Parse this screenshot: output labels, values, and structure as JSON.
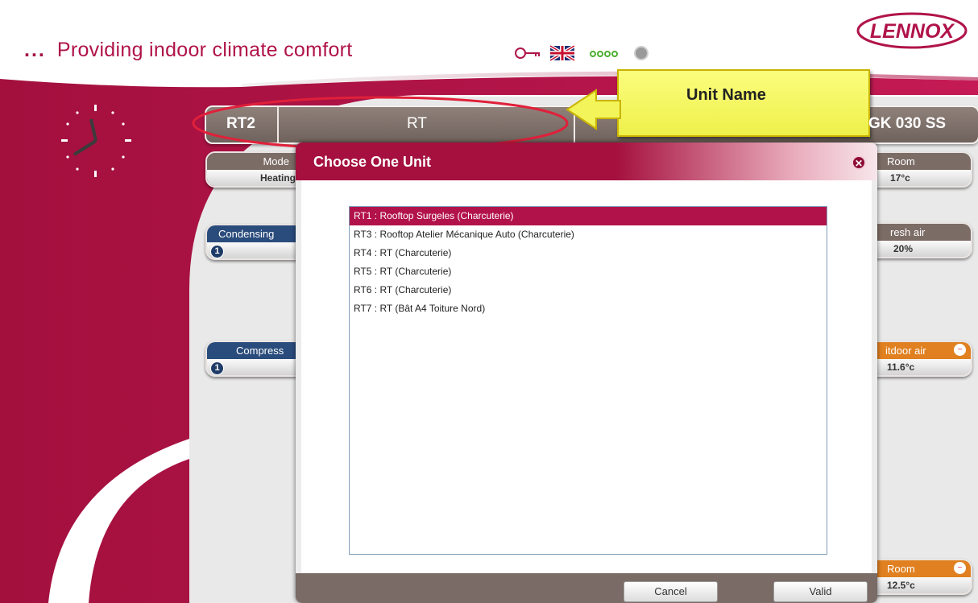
{
  "header": {
    "tagline_dots": "...",
    "tagline": "Providing indoor climate comfort",
    "logo_text": "LENNOX"
  },
  "unit_bar": {
    "unit_id": "RT2",
    "unit_name": "RT",
    "model": "GK 030 SS"
  },
  "callout": {
    "label": "Unit Name"
  },
  "left_panels": {
    "mode": {
      "label": "Mode",
      "value": "Heating"
    },
    "condensing": {
      "label": "Condensing",
      "badge": "1"
    },
    "compressor": {
      "label": "Compress",
      "badge": "1"
    }
  },
  "right_panels": {
    "room": {
      "label": "Room",
      "value": "17°c"
    },
    "fresh_air": {
      "label": "resh air",
      "value": "20%"
    },
    "outdoor_air": {
      "label": "itdoor air",
      "value": "11.6°c"
    },
    "room2": {
      "label": "Room",
      "value": "12.5°c"
    }
  },
  "dialog": {
    "title": "Choose One Unit",
    "items": [
      "RT1 : Rooftop Surgeles (Charcuterie)",
      "RT3 : Rooftop Atelier Mécanique Auto (Charcuterie)",
      "RT4 : RT (Charcuterie)",
      "RT5 : RT (Charcuterie)",
      "RT6 : RT (Charcuterie)",
      "RT7 : RT (Bât A4 Toiture Nord)"
    ],
    "selected_index": 0,
    "cancel_label": "Cancel",
    "valid_label": "Valid"
  },
  "colors": {
    "brand": "#a4123f",
    "panel_brown": "#7c6c66",
    "panel_blue": "#2a4c7c",
    "panel_orange": "#e08020",
    "callout": "#f2f45a"
  },
  "icons": [
    "key-icon",
    "uk-flag-icon",
    "connection-dots-icon",
    "status-led-icon",
    "clock-icon",
    "close-icon",
    "wave-icon",
    "arrow-icon"
  ]
}
